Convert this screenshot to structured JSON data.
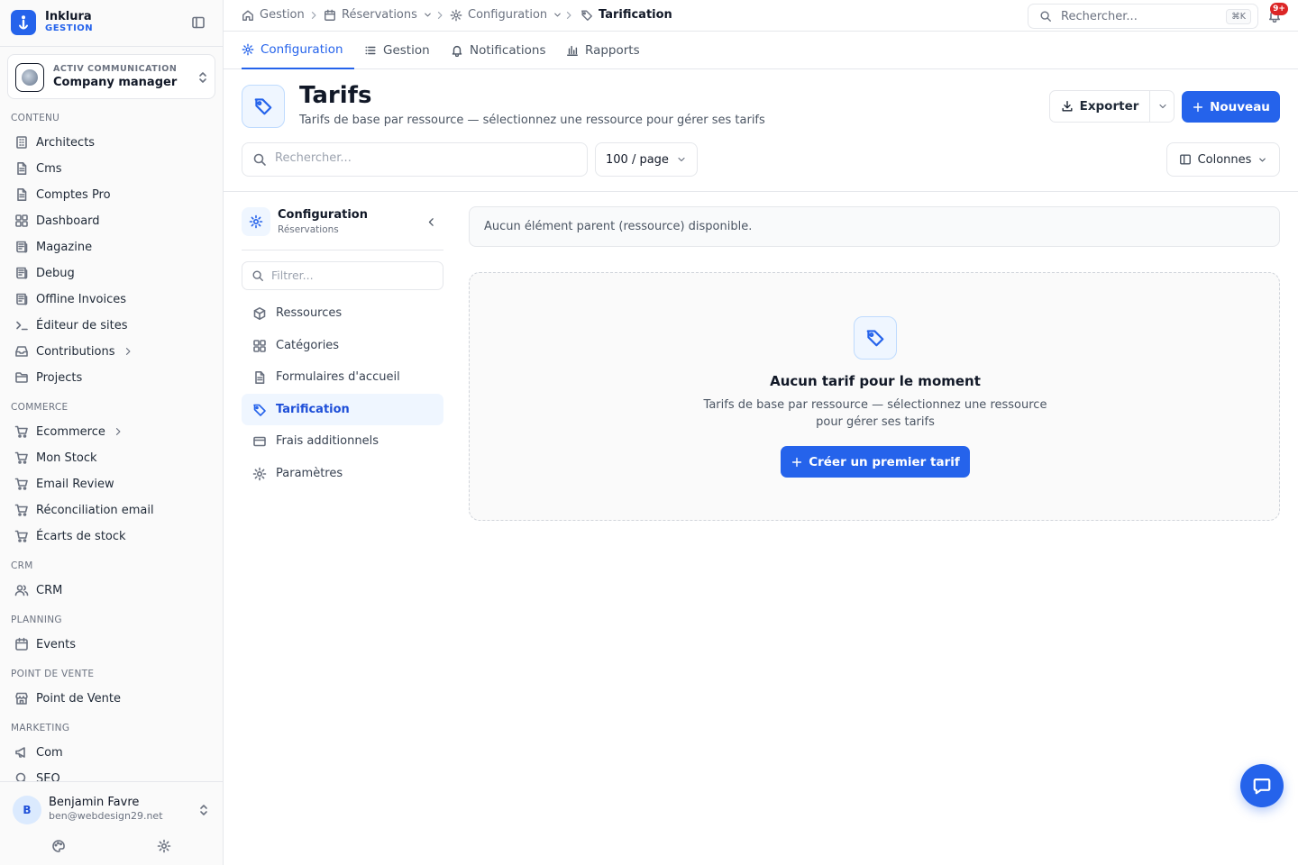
{
  "app": {
    "name": "Inklura",
    "subtitle": "GESTION"
  },
  "org": {
    "label": "ACTIV COMMUNICATION",
    "role": "Company manager"
  },
  "sidebar": {
    "sections": [
      {
        "title": "CONTENU",
        "items": [
          {
            "label": "Architects",
            "icon": "building-icon"
          },
          {
            "label": "Cms",
            "icon": "document-icon"
          },
          {
            "label": "Comptes Pro",
            "icon": "document-icon"
          },
          {
            "label": "Dashboard",
            "icon": "grid-icon"
          },
          {
            "label": "Magazine",
            "icon": "newspaper-icon"
          },
          {
            "label": "Debug",
            "icon": "newspaper-icon"
          },
          {
            "label": "Offline Invoices",
            "icon": "newspaper-icon"
          },
          {
            "label": "Éditeur de sites",
            "icon": "terminal-icon"
          },
          {
            "label": "Contributions",
            "icon": "inbox-icon",
            "has_children": true
          },
          {
            "label": "Projects",
            "icon": "folder-icon"
          }
        ]
      },
      {
        "title": "COMMERCE",
        "items": [
          {
            "label": "Ecommerce",
            "icon": "cart-icon",
            "has_children": true
          },
          {
            "label": "Mon Stock",
            "icon": "cart-icon"
          },
          {
            "label": "Email Review",
            "icon": "cart-icon"
          },
          {
            "label": "Réconciliation email",
            "icon": "cart-icon"
          },
          {
            "label": "Écarts de stock",
            "icon": "cart-icon"
          }
        ]
      },
      {
        "title": "CRM",
        "items": [
          {
            "label": "CRM",
            "icon": "users-icon"
          }
        ]
      },
      {
        "title": "PLANNING",
        "items": [
          {
            "label": "Events",
            "icon": "calendar-icon"
          }
        ]
      },
      {
        "title": "POINT DE VENTE",
        "items": [
          {
            "label": "Point de Vente",
            "icon": "store-icon"
          }
        ]
      },
      {
        "title": "MARKETING",
        "items": [
          {
            "label": "Com",
            "icon": "megaphone-icon"
          },
          {
            "label": "SEO",
            "icon": "search-icon"
          }
        ]
      }
    ]
  },
  "user": {
    "initial": "B",
    "name": "Benjamin Favre",
    "email": "ben@webdesign29.net"
  },
  "breadcrumb": [
    {
      "label": "Gestion",
      "icon": "home-icon"
    },
    {
      "label": "Réservations",
      "icon": "calendar-icon",
      "dropdown": true
    },
    {
      "label": "Configuration",
      "icon": "gear-icon",
      "dropdown": true
    },
    {
      "label": "Tarification",
      "icon": "tag-icon",
      "current": true
    }
  ],
  "topsearch": {
    "placeholder": "Rechercher...",
    "shortcut": "⌘K"
  },
  "notifications": {
    "badge": "9+"
  },
  "tabs": [
    {
      "label": "Configuration",
      "icon": "gear-icon",
      "active": true
    },
    {
      "label": "Gestion",
      "icon": "list-icon"
    },
    {
      "label": "Notifications",
      "icon": "bell-icon"
    },
    {
      "label": "Rapports",
      "icon": "bar-chart-icon"
    }
  ],
  "page": {
    "title": "Tarifs",
    "subtitle": "Tarifs de base par ressource — sélectionnez une ressource pour gérer ses tarifs",
    "export_label": "Exporter",
    "new_label": "Nouveau",
    "search_placeholder": "Rechercher...",
    "per_page": "100 / page",
    "columns_label": "Colonnes"
  },
  "subnav": {
    "title": "Configuration",
    "subtitle": "Réservations",
    "filter_placeholder": "Filtrer...",
    "items": [
      {
        "label": "Ressources",
        "icon": "box-icon"
      },
      {
        "label": "Catégories",
        "icon": "grid-icon"
      },
      {
        "label": "Formulaires d'accueil",
        "icon": "document-icon"
      },
      {
        "label": "Tarification",
        "icon": "tag-icon",
        "active": true
      },
      {
        "label": "Frais additionnels",
        "icon": "credit-card-icon"
      },
      {
        "label": "Paramètres",
        "icon": "gear-icon"
      }
    ]
  },
  "notice": "Aucun élément parent (ressource) disponible.",
  "empty_state": {
    "title": "Aucun tarif pour le moment",
    "description": "Tarifs de base par ressource — sélectionnez une ressource pour gérer ses tarifs",
    "button": "Créer un premier tarif"
  },
  "colors": {
    "accent": "#2563eb",
    "badge": "#dc2626"
  }
}
